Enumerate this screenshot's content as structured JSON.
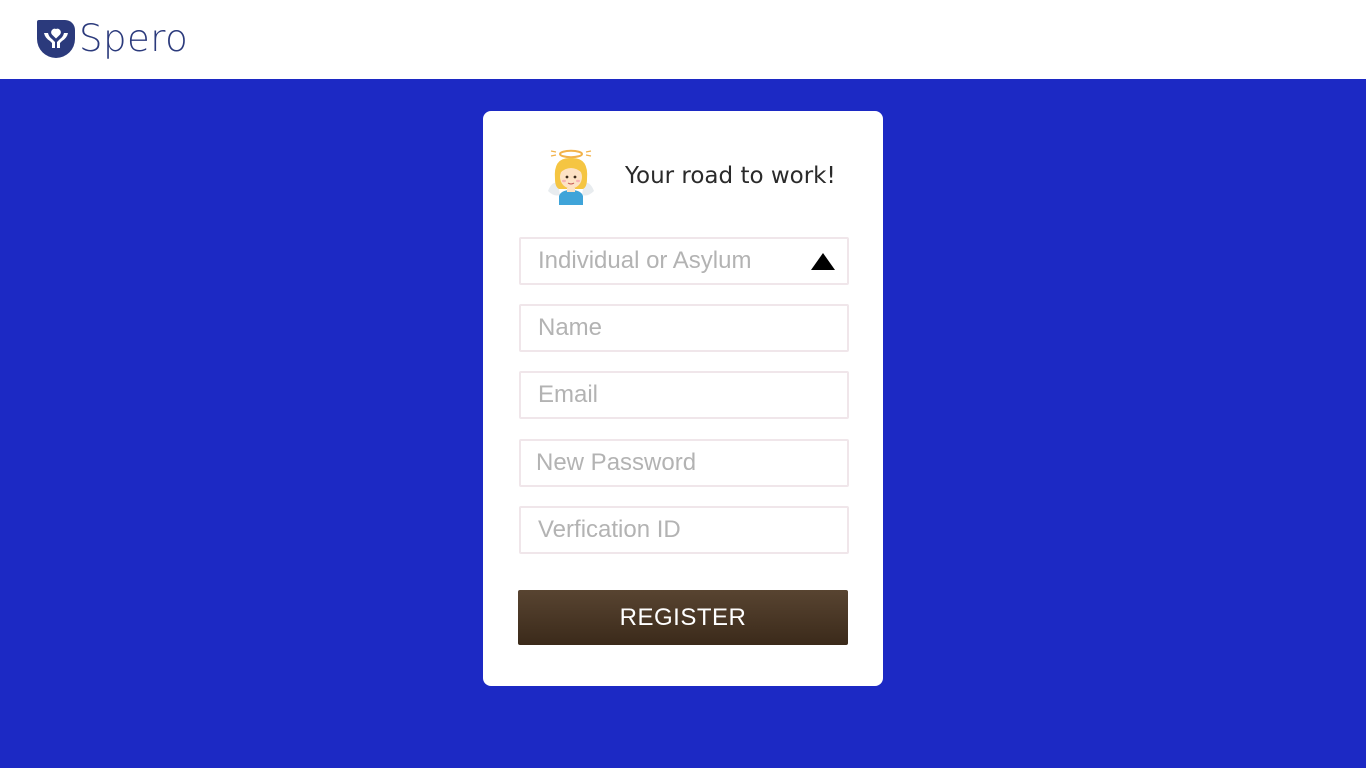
{
  "brand": {
    "name": "Spero",
    "logo_icon": "hands-holding-heart-icon",
    "color": "#2b3a7c"
  },
  "theme": {
    "background": "#1c29c4",
    "button_color": "#4a3826"
  },
  "card": {
    "icon": "angel-emoji-icon",
    "tagline": "Your road to work!"
  },
  "form": {
    "type_select": {
      "placeholder": "Individual or Asylum",
      "icon": "caret-up-icon"
    },
    "name": {
      "placeholder": "Name"
    },
    "email": {
      "placeholder": "Email"
    },
    "password": {
      "placeholder": "New Password"
    },
    "verification": {
      "placeholder": "Verfication ID"
    },
    "submit_label": "REGISTER"
  }
}
